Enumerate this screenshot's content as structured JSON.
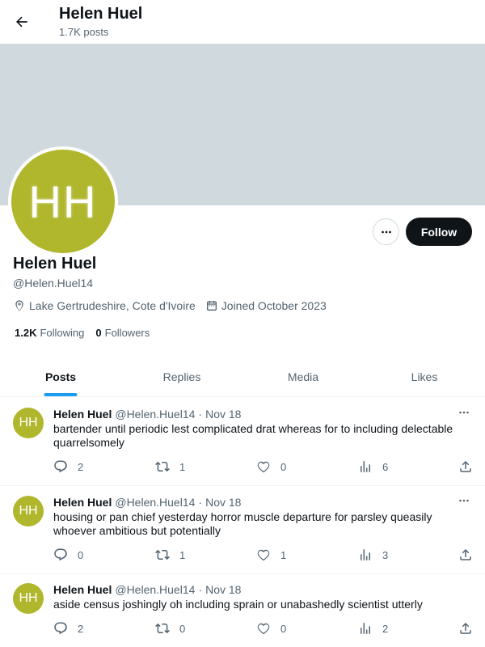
{
  "header": {
    "title": "Helen Huel",
    "subtitle": "1.7K posts"
  },
  "colors": {
    "avatar": "#b0b72d",
    "banner": "#cfd9de",
    "accent": "#1d9bf0"
  },
  "profile": {
    "initials": "HH",
    "name": "Helen Huel",
    "handle": "@Helen.Huel14",
    "location": "Lake Gertrudeshire, Cote d'Ivoire",
    "joined": "Joined October 2023",
    "following_count": "1.2K",
    "following_label": "Following",
    "followers_count": "0",
    "followers_label": "Followers",
    "follow_label": "Follow"
  },
  "tabs": [
    {
      "label": "Posts",
      "active": true
    },
    {
      "label": "Replies",
      "active": false
    },
    {
      "label": "Media",
      "active": false
    },
    {
      "label": "Likes",
      "active": false
    }
  ],
  "posts": [
    {
      "initials": "HH",
      "name": "Helen Huel",
      "handle": "@Helen.Huel14",
      "sep": "·",
      "date": "Nov 18",
      "text": "bartender until periodic lest complicated drat whereas for to including delectable quarrelsomely",
      "replies": "2",
      "reposts": "1",
      "likes": "0",
      "views": "6"
    },
    {
      "initials": "HH",
      "name": "Helen Huel",
      "handle": "@Helen.Huel14",
      "sep": "·",
      "date": "Nov 18",
      "text": "housing or pan chief yesterday horror muscle departure for parsley queasily whoever ambitious but potentially",
      "replies": "0",
      "reposts": "1",
      "likes": "1",
      "views": "3"
    },
    {
      "initials": "HH",
      "name": "Helen Huel",
      "handle": "@Helen.Huel14",
      "sep": "·",
      "date": "Nov 18",
      "text": "aside census joshingly oh including sprain or unabashedly scientist utterly",
      "replies": "2",
      "reposts": "0",
      "likes": "0",
      "views": "2"
    }
  ]
}
